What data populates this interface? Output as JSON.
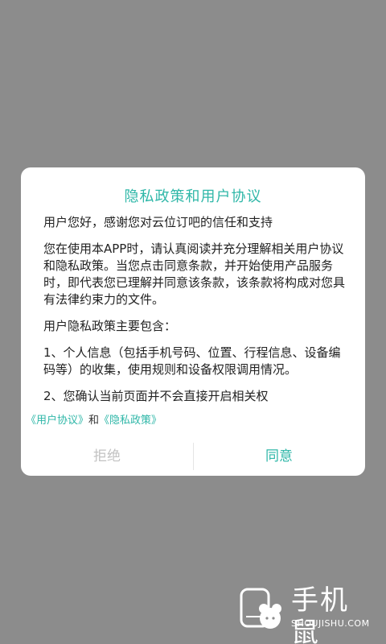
{
  "dialog": {
    "title": "隐私政策和用户协议",
    "paragraphs": [
      "用户您好，感谢您对云位订吧的信任和支持",
      "您在使用本APP时，请认真阅读并充分理解相关用户协议和隐私政策。当您点击同意条款，并开始使用产品服务时，即代表您已理解并同意该条款，该条款将构成对您具有法律约束力的文件。",
      "用户隐私政策主要包含：",
      "1、个人信息（包括手机号码、位置、行程信息、设备编码等）的收集，使用规则和设备权限调用情况。",
      "2、您确认当前页面并不会直接开启相关权"
    ],
    "links": {
      "user_agreement": "《用户协议》",
      "connector": "和",
      "privacy_policy": "《隐私政策》"
    },
    "buttons": {
      "reject": "拒绝",
      "agree": "同意"
    }
  },
  "watermark": {
    "name": "手机鼠",
    "url": "SHOUJISHU.COM"
  },
  "colors": {
    "overlay": "#8c8c8c",
    "accent": "#2fb7a8",
    "disabled": "#c2c2c2"
  }
}
